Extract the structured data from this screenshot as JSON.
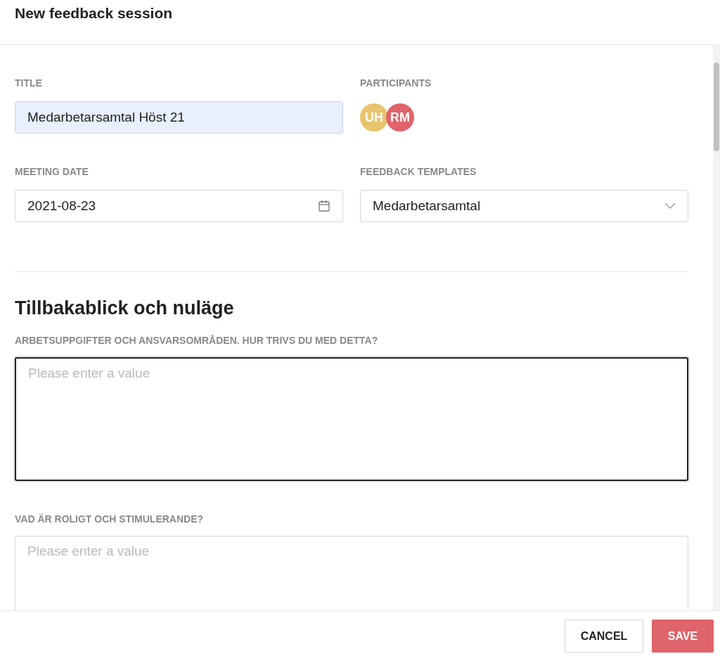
{
  "window": {
    "title": "New feedback session"
  },
  "title_field": {
    "label": "TITLE",
    "value": "Medarbetarsamtal Höst 21"
  },
  "participants": {
    "label": "PARTICIPANTS",
    "people": [
      {
        "initials": "UH",
        "color": "#e8c46c"
      },
      {
        "initials": "RM",
        "color": "#e0646b"
      }
    ]
  },
  "meeting_date": {
    "label": "MEETING DATE",
    "value": "2021-08-23"
  },
  "feedback_templates": {
    "label": "FEEDBACK TEMPLATES",
    "value": "Medarbetarsamtal"
  },
  "section": {
    "heading": "Tillbakablick och nuläge",
    "questions": [
      {
        "label": "ARBETSUPPGIFTER OCH ANSVARSOMRÅDEN. HUR TRIVS DU MED DETTA?",
        "placeholder": "Please enter a value",
        "focused": true
      },
      {
        "label": "VAD ÄR ROLIGT OCH STIMULERANDE?",
        "placeholder": "Please enter a value",
        "focused": false
      }
    ]
  },
  "buttons": [
    {
      "label": "CANCEL",
      "kind": "secondary"
    },
    {
      "label": "SAVE",
      "kind": "primary"
    }
  ]
}
